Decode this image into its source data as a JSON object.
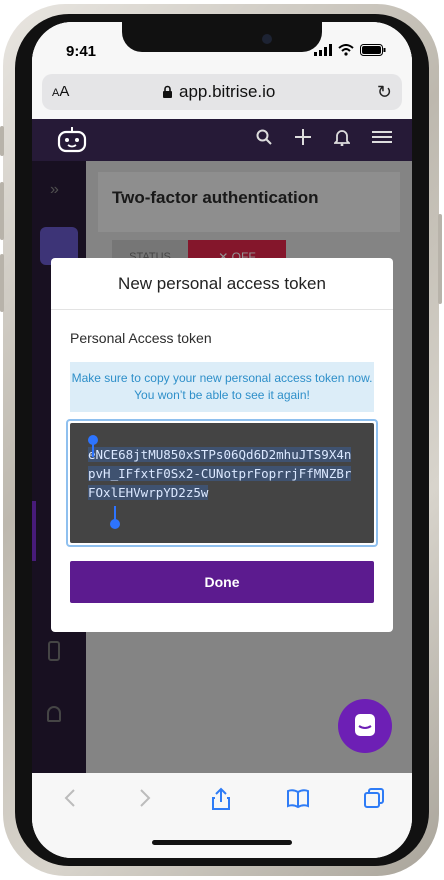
{
  "status_bar": {
    "time": "9:41"
  },
  "browser": {
    "text_size_label_small": "A",
    "text_size_label_large": "A",
    "url": "app.bitrise.io"
  },
  "background": {
    "card_title": "Two-factor authentication",
    "status_label": "STATUS",
    "toggle_label": "✕ OFF"
  },
  "modal": {
    "title": "New personal access token",
    "field_label": "Personal Access token",
    "note": "Make sure to copy your new personal access token now. You won’t be able to see it again!",
    "token": "eNCE68jtMU850xSTPs06Qd6D2mhuJTS9X4npvH_IFfxtF0Sx2-CUNotprFoprrjFfMNZBrFOxlEHVwrpYD2z5w",
    "done_label": "Done"
  },
  "colors": {
    "app_header": "#261a37",
    "done_button": "#5c1b8f",
    "note_bg": "#dcedf8",
    "note_text": "#2e8fc9",
    "chat_bubble": "#6d1fb5"
  }
}
